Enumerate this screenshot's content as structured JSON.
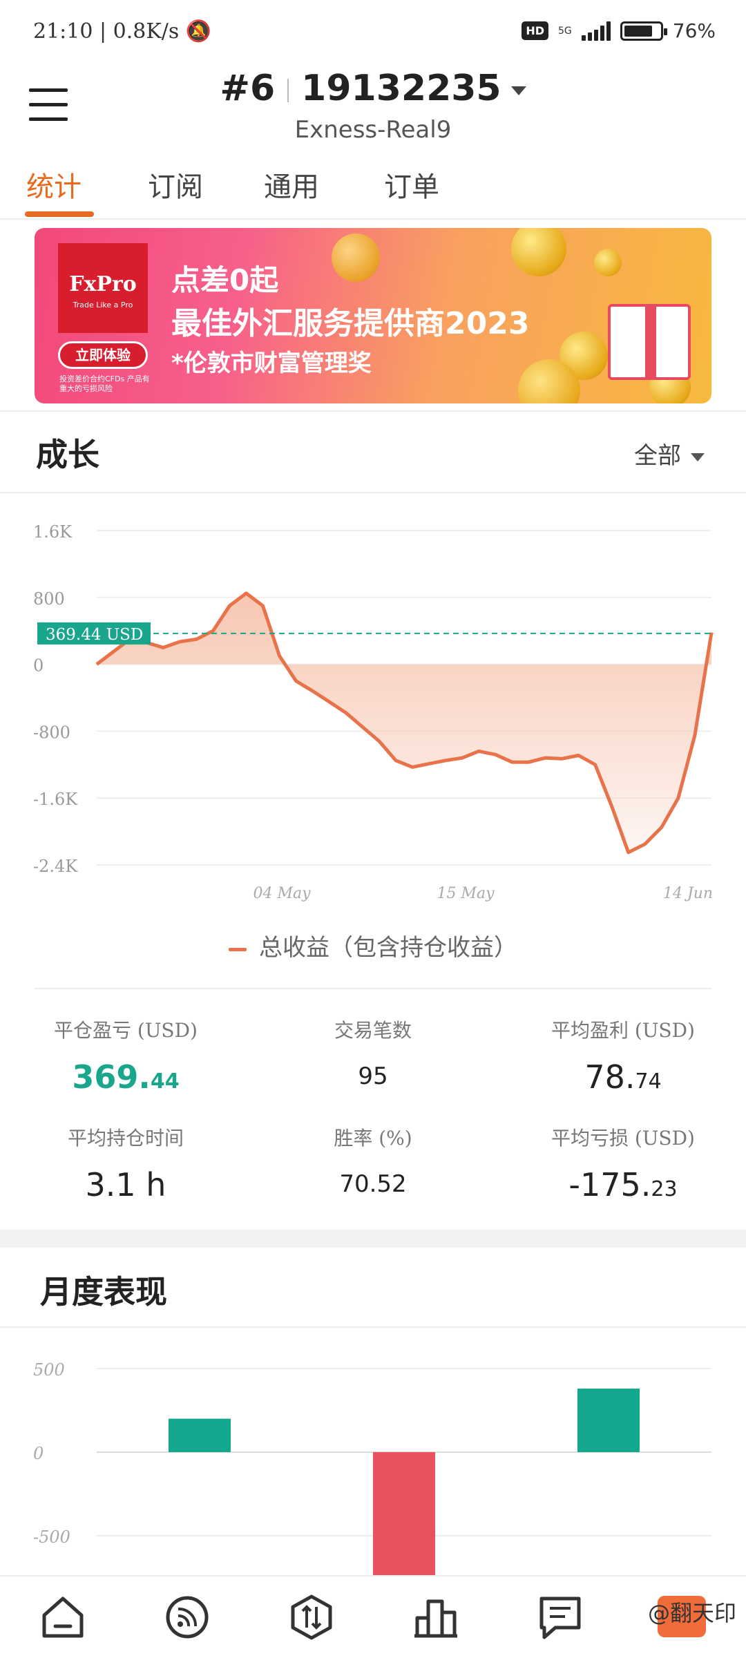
{
  "status_bar": {
    "time": "21:10",
    "speed": "0.8K/s",
    "hd": "HD",
    "network": "5G",
    "battery": "76%"
  },
  "header": {
    "account_prefix": "#6",
    "account_number": "19132235",
    "server": "Exness-Real9"
  },
  "tabs": [
    {
      "label": "统计",
      "active": true
    },
    {
      "label": "订阅",
      "active": false
    },
    {
      "label": "通用",
      "active": false
    },
    {
      "label": "订单",
      "active": false
    }
  ],
  "banner": {
    "logo": "FxPro",
    "logo_tagline": "Trade Like a Pro",
    "cta": "立即体验",
    "disclaimer": "投资差价合约CFDs 产品有重大的亏损风险",
    "line1": "点差0起",
    "line2": "最佳外汇服务提供商2023",
    "line3": "*伦敦市财富管理奖"
  },
  "growth": {
    "title": "成长",
    "range": "全部",
    "legend": "总收益（包含持仓收益）"
  },
  "chart_data": [
    {
      "type": "area",
      "y_ticks": [
        "1.6K",
        "800",
        "0",
        "-800",
        "-1.6K",
        "-2.4K"
      ],
      "x_ticks": [
        "04 May",
        "15 May",
        "14 Jun"
      ],
      "ylim": [
        -2400,
        1600
      ],
      "current_label": "369.44 USD",
      "current_value": 369.44,
      "colors": {
        "line": "#e8734a",
        "fill": "#f6c1aa",
        "ref": "#1aa58d"
      },
      "series": [
        {
          "values": [
            0,
            150,
            300,
            260,
            200,
            270,
            300,
            400,
            700,
            850,
            700,
            100,
            -200,
            -320,
            -450,
            -580,
            -750,
            -920,
            -1150,
            -1230,
            -1190,
            -1150,
            -1120,
            -1040,
            -1080,
            -1170,
            -1170,
            -1120,
            -1130,
            -1090,
            -1200,
            -1700,
            -2250,
            -2150,
            -1950,
            -1600,
            -850,
            380
          ]
        }
      ]
    },
    {
      "type": "bar",
      "y_ticks": [
        "500",
        "0",
        "-500"
      ],
      "ylim": [
        -700,
        600
      ],
      "values": [
        200,
        -750,
        380
      ],
      "colors": {
        "positive": "#13a88e",
        "negative": "#e9515f"
      }
    }
  ],
  "stats": [
    {
      "label": "平仓盈亏 (USD)",
      "int": "369.",
      "dec": "44"
    },
    {
      "label": "交易笔数",
      "value": "95"
    },
    {
      "label": "平均盈利 (USD)",
      "int": "78.",
      "dec": "74"
    },
    {
      "label": "平均持仓时间",
      "value": "3.1 h"
    },
    {
      "label": "胜率 (%)",
      "value": "70.52"
    },
    {
      "label": "平均亏损 (USD)",
      "int": "-175.",
      "dec": "23"
    }
  ],
  "monthly": {
    "title": "月度表现"
  },
  "watermark": "@翻天印"
}
